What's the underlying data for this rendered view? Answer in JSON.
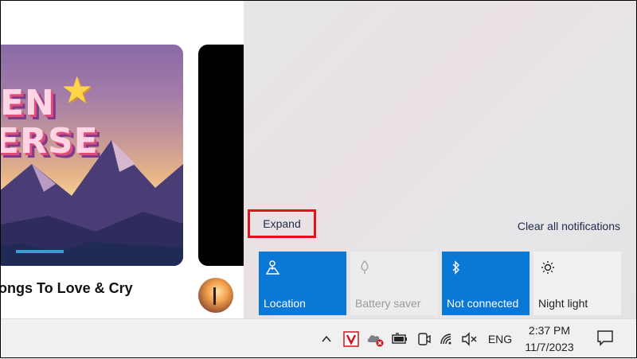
{
  "app": {
    "playlist_title": "ongs To Love & Cry",
    "cover_logo_top": "EN",
    "cover_logo_bottom": "ERSE"
  },
  "action_center": {
    "expand_label": "Expand",
    "clear_label": "Clear all notifications",
    "tiles": [
      {
        "label": "Location",
        "icon": "location-icon",
        "state": "on"
      },
      {
        "label": "Battery saver",
        "icon": "battery-saver-icon",
        "state": "disabled"
      },
      {
        "label": "Not connected",
        "icon": "bluetooth-icon",
        "state": "on"
      },
      {
        "label": "Night light",
        "icon": "night-light-icon",
        "state": "off"
      }
    ],
    "colors": {
      "tile_on": "#0a78d7",
      "highlight": "#e0141c"
    }
  },
  "taskbar": {
    "language": "ENG",
    "time": "2:37 PM",
    "date": "11/7/2023",
    "tray_icons": [
      "chevron-up-icon",
      "antivirus-icon",
      "onedrive-error-icon",
      "battery-icon",
      "meet-now-icon",
      "wifi-icon",
      "volume-muted-icon"
    ]
  }
}
